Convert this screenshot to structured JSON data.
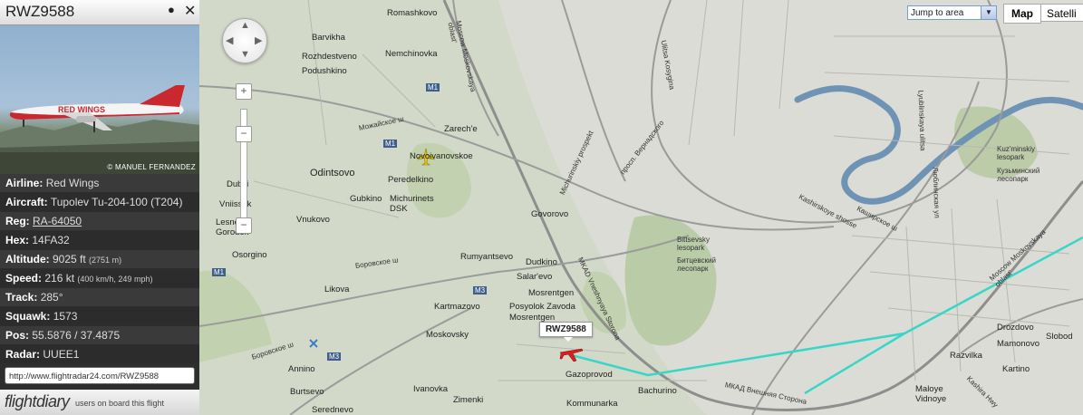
{
  "panel": {
    "callsign": "RWZ9588",
    "photo_credit": "© MANUEL FERNANDEZ",
    "photo_livery": "RED WINGS",
    "rows": {
      "airline": {
        "label": "Airline:",
        "value": "Red Wings"
      },
      "aircraft": {
        "label": "Aircraft:",
        "value": "Tupolev Tu-204-100 (T204)"
      },
      "reg": {
        "label": "Reg:",
        "value": "RA-64050"
      },
      "hex": {
        "label": "Hex:",
        "value": "14FA32"
      },
      "altitude": {
        "label": "Altitude:",
        "value": "9025 ft",
        "sub": "(2751 m)"
      },
      "speed": {
        "label": "Speed:",
        "value": "216 kt",
        "sub": "(400 km/h, 249 mph)"
      },
      "track": {
        "label": "Track:",
        "value": "285°"
      },
      "squawk": {
        "label": "Squawk:",
        "value": "1573"
      },
      "pos": {
        "label": "Pos:",
        "value": "55.5876 / 37.4875"
      },
      "radar": {
        "label": "Radar:",
        "value": "UUEE1"
      }
    },
    "url": "http://www.flightradar24.com/RWZ9588",
    "footer": {
      "logo": "flightdiary",
      "tagline": "users on board this flight"
    }
  },
  "map": {
    "controls": {
      "jump_label": "Jump to area",
      "map_button": "Map",
      "satellite_button": "Satelli",
      "zoom_in": "+",
      "zoom_out": "−"
    },
    "flight_callout": "RWZ9588",
    "colors": {
      "track": "#38d6c8",
      "selected_plane": "#d82020",
      "other_plane": "#e8c800",
      "water": "#6f93b5"
    },
    "places": {
      "romashkovo": "Romashkovo",
      "barvikha": "Barvikha",
      "rozhdestveno": "Rozhdestveno",
      "podushkino": "Podushkino",
      "nemchinovka": "Nemchinovka",
      "zarechye": "Zarech'e",
      "novoivanovskoe": "Novoivanovskoe",
      "peredelkino": "Peredelkino",
      "odintsovo": "Odintsovo",
      "gubkino": "Gubkino",
      "michurinets": "Michurinets DSK",
      "dubki": "Dubki",
      "vniissok": "Vniissok",
      "lesnoy": "Lesnoy Gorodok",
      "vnukovo": "Vnukovo",
      "osorgino": "Osorgino",
      "govorovo": "Govorovo",
      "rumyantsevo": "Rumyantsevo",
      "dudkino": "Dudkino",
      "salarevo": "Salar'evo",
      "likova": "Likova",
      "kartmazovo": "Kartmazovo",
      "mosrentgen": "Mosrentgen",
      "posyolok": "Posyolok Zavoda Mosrentgen",
      "moskovsky": "Moskovsky",
      "annino": "Annino",
      "burtsevo": "Burtsevo",
      "ivanovka": "Ivanovka",
      "zimenki": "Zimenki",
      "gazoprovod": "Gazoprovod",
      "kommunarka": "Kommunarka",
      "bachurino": "Bachurino",
      "serednevo": "Serednevo",
      "bitsevsky": "Bittsevsky lesopark",
      "bitsevsky_ru": "Битцевский лесопарк",
      "kuzminsky": "Kuz'minskiy lesopark",
      "kuzminsky_ru": "Кузьминский лесопарк",
      "drozdovo": "Drozdovo",
      "mamonovo": "Mamonovo",
      "razvilka": "Razvilka",
      "kartino": "Kartino",
      "sloboda": "Slobod",
      "maloye": "Maloye Vidnoye",
      "moscow_oblast": "Moscow Moskovskaya oblast'",
      "moscow_oblast_right": "Moscow Moskovskaya oblast'"
    },
    "roads": {
      "m1_a": "M1",
      "m1_b": "M1",
      "m1_c": "M1",
      "m3_a": "M3",
      "m3_b": "M3",
      "mozhaiskoe": "Можайское ш",
      "borovskoe": "Боровское ш",
      "borovskoe2": "Боровское ш",
      "michurinsky": "Michurinskiy prospekt",
      "vernadskogo": "просп. Вернадского",
      "kosygina": "Ulitsa Kosygina",
      "kashirskoye": "Kashirskoye shosse",
      "kashirskoye_ru": "Каширское ш",
      "mkad": "МКАД Внешняя Сторона",
      "mkad_vnesh": "MKAD Vneshnyaya Storona",
      "lyublinskaya": "Lyublinskaya ulitsa",
      "lyublinskaya_ru": "Люблинская ул",
      "kashira_hwy": "Kashira Hwy"
    }
  }
}
